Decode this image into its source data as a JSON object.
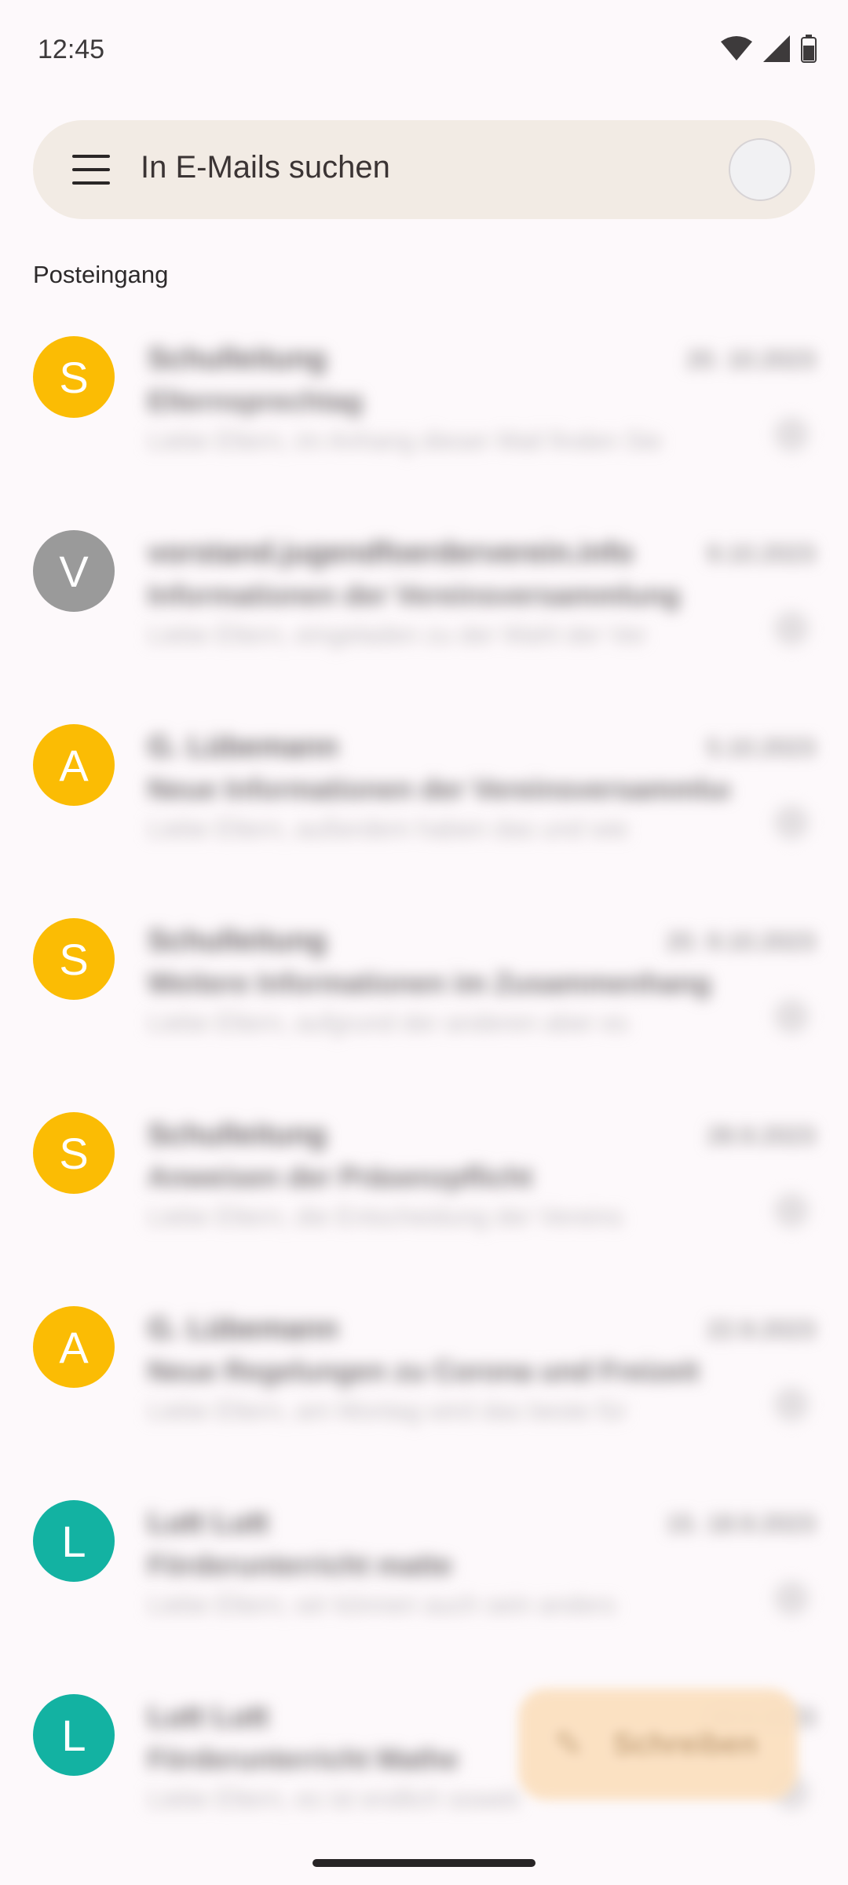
{
  "status_bar": {
    "time": "12:45",
    "icons": [
      "wifi-icon",
      "cell-signal-icon",
      "battery-icon"
    ]
  },
  "search": {
    "placeholder": "In E-Mails suchen"
  },
  "section": {
    "label": "Posteingang"
  },
  "colors": {
    "avatar_yellow": "#fbbc04",
    "avatar_gray": "#9a9a9a",
    "avatar_teal": "#13b2a2",
    "compose_fab": "#fbe0c0"
  },
  "emails": [
    {
      "initial": "S",
      "avatar_color": "#fbbc04",
      "sender": "Schulleitung",
      "date": "20. 10.2023",
      "subject": "Elternsprechtag",
      "snippet": "Liebe Eltern, im Anhang dieser Mail finden Sie"
    },
    {
      "initial": "V",
      "avatar_color": "#9a9a9a",
      "sender": "vorstand.jugendfoerderverein.info",
      "date": "9.10.2023",
      "subject": "Informationen der Vereinsversammlung",
      "snippet": "Liebe Eltern, eingeladen zu der Wahl der Ver"
    },
    {
      "initial": "A",
      "avatar_color": "#fbbc04",
      "sender": "G. Lübemann",
      "date": "5.10.2023",
      "subject": "Neue Informationen der Vereinsversammlung",
      "snippet": "Liebe Eltern, außerdem haben das und wie"
    },
    {
      "initial": "S",
      "avatar_color": "#fbbc04",
      "sender": "Schulleitung",
      "date": "20. 9.10.2023",
      "subject": "Weitere Informationen im Zusammenhang",
      "snippet": "Liebe Eltern, aufgrund der anderen aber es"
    },
    {
      "initial": "S",
      "avatar_color": "#fbbc04",
      "sender": "Schulleitung",
      "date": "28.9.2023",
      "subject": "Anweisen der Präsenzpflicht",
      "snippet": "Liebe Eltern, die Entscheidung der Vereins"
    },
    {
      "initial": "A",
      "avatar_color": "#fbbc04",
      "sender": "G. Lübemann",
      "date": "22.9.2023",
      "subject": "Neue Regelungen zu Corona und Freizeit",
      "snippet": "Liebe Eltern, am Montag wird das beste für"
    },
    {
      "initial": "L",
      "avatar_color": "#13b2a2",
      "sender": "Lutt Lutt",
      "date": "15. 18.9.2023",
      "subject": "Förderunterricht matte",
      "snippet": "Liebe Eltern, wir können auch sein anders"
    },
    {
      "initial": "L",
      "avatar_color": "#13b2a2",
      "sender": "Lutt Lutt",
      "date": "18.9.2023",
      "subject": "Förderunterricht Mathe",
      "snippet": "Liebe Eltern, es ist endlich soweit"
    }
  ],
  "compose": {
    "label": "Schreiben",
    "icon": "pencil-icon"
  }
}
